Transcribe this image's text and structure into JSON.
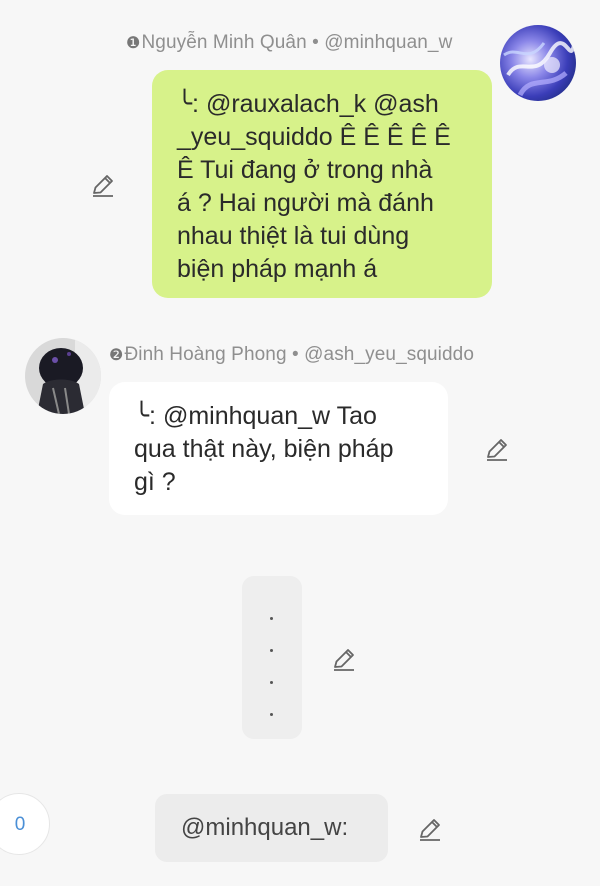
{
  "messages": [
    {
      "rank_glyph": "❶",
      "sender_name": "Nguyễn Minh Quân",
      "separator": " • ",
      "sender_handle": "@minhquan_w",
      "avatar_icon": "avatar-anime-blue",
      "bubble_color": "#d7f28a",
      "lines": [
        "╰: @rauxalach_k @ash",
        "_yeu_squiddo Ê Ê Ê Ê Ê",
        "Ê Tui đang ở trong nhà",
        "á ? Hai người mà đánh",
        "nhau thiệt là tui dùng",
        "biện pháp mạnh á"
      ]
    },
    {
      "rank_glyph": "❷",
      "sender_name": "Đinh Hoàng Phong",
      "separator": " • ",
      "sender_handle": "@ash_yeu_squiddo",
      "avatar_icon": "avatar-dark-character",
      "bubble_color": "#ffffff",
      "lines": [
        "╰: @minhquan_w Tao",
        "qua thật này, biện pháp",
        "gì ?"
      ]
    }
  ],
  "typing_indicator": {
    "dots": [
      ".",
      ".",
      ".",
      "."
    ]
  },
  "composer": {
    "text": "@minhquan_w:"
  },
  "badge": {
    "count": "0",
    "color": "#4a8fd6"
  },
  "icons": {
    "edit": "pencil-icon"
  }
}
